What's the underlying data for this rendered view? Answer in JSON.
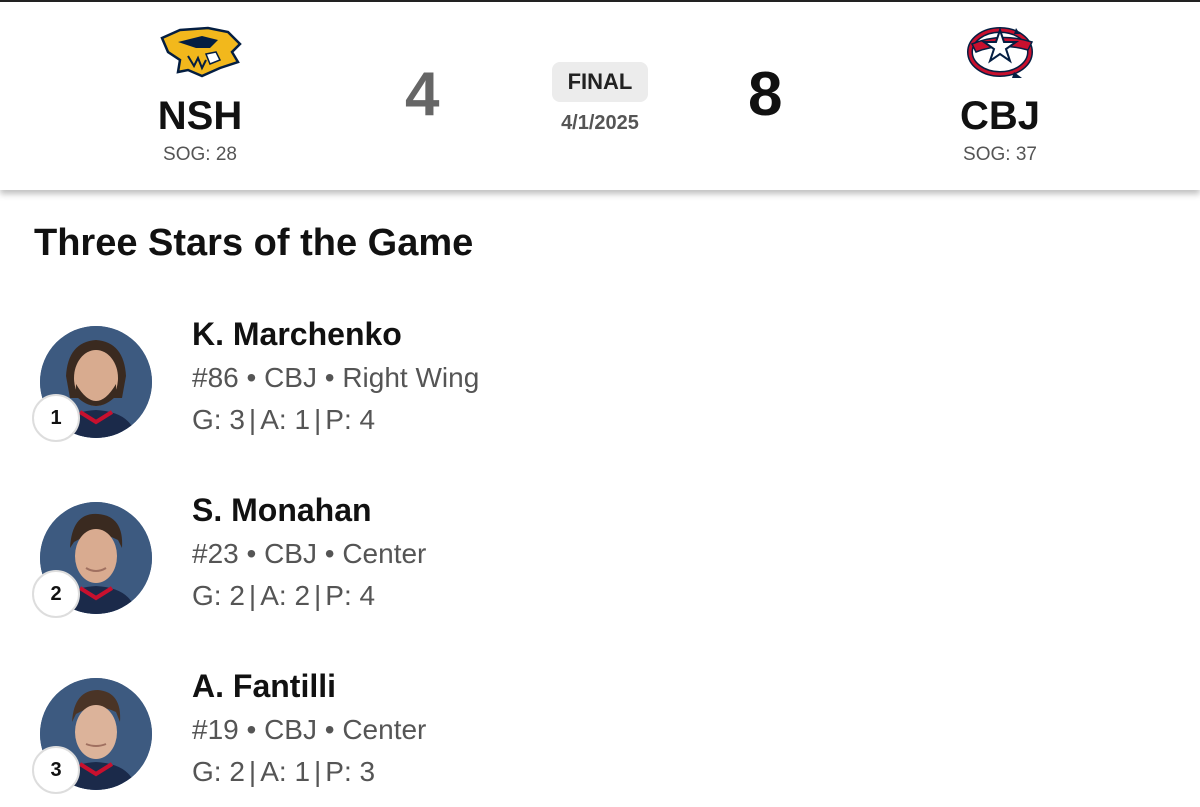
{
  "game": {
    "status": "FINAL",
    "date": "4/1/2025",
    "away": {
      "abbr": "NSH",
      "score": "4",
      "sog": "SOG: 28",
      "logo_icon": "nashville-predators-logo-icon"
    },
    "home": {
      "abbr": "CBJ",
      "score": "8",
      "sog": "SOG: 37",
      "logo_icon": "columbus-blue-jackets-logo-icon"
    }
  },
  "three_stars": {
    "title": "Three Stars of the Game",
    "players": [
      {
        "rank": "1",
        "name": "K. Marchenko",
        "info": "#86 • CBJ • Right Wing",
        "g": "G: 3",
        "a": "A: 1",
        "p": "P: 4"
      },
      {
        "rank": "2",
        "name": "S. Monahan",
        "info": "#23 • CBJ • Center",
        "g": "G: 2",
        "a": "A: 2",
        "p": "P: 4"
      },
      {
        "rank": "3",
        "name": "A. Fantilli",
        "info": "#19 • CBJ • Center",
        "g": "G: 2",
        "a": "A: 1",
        "p": "P: 3"
      }
    ]
  },
  "colors": {
    "headshot_bg": "#3d5a80",
    "jersey": "#1b2a4a",
    "jersey_trim": "#c8102e",
    "predators_gold": "#f2b81c",
    "predators_navy": "#041e42"
  }
}
